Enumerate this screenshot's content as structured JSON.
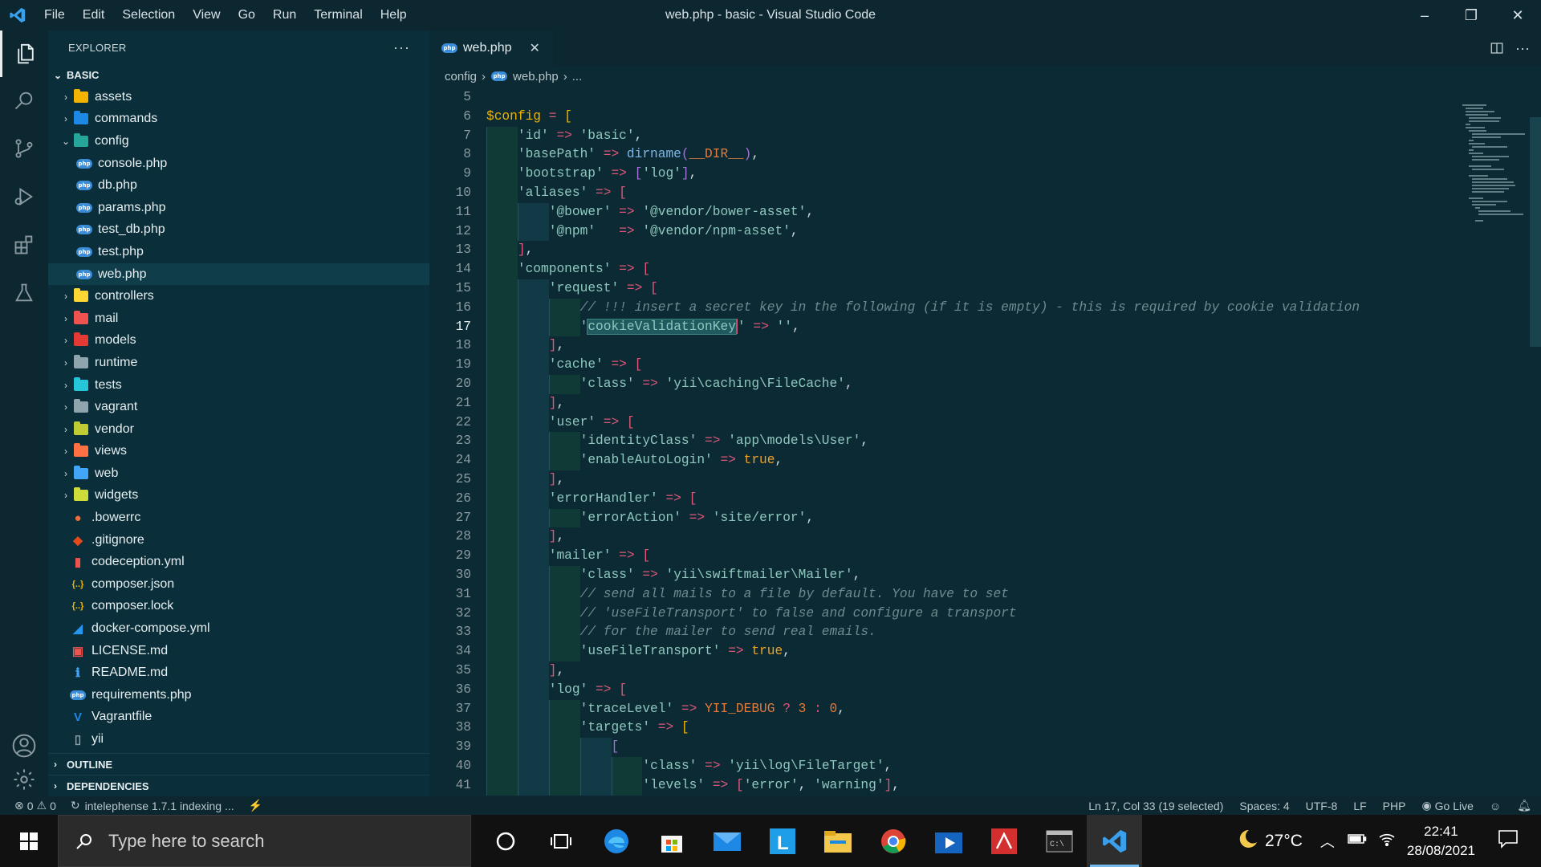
{
  "window": {
    "title": "web.php - basic - Visual Studio Code",
    "menu": [
      "File",
      "Edit",
      "Selection",
      "View",
      "Go",
      "Run",
      "Terminal",
      "Help"
    ],
    "controls": [
      "–",
      "❐",
      "✕"
    ]
  },
  "activity_bar": {
    "items": [
      "explorer-icon",
      "search-icon",
      "source-control-icon",
      "run-debug-icon",
      "extensions-icon",
      "testing-icon"
    ],
    "bottom": [
      "accounts-icon",
      "settings-gear-icon"
    ]
  },
  "sidebar": {
    "title": "EXPLORER",
    "more": "···",
    "root": "BASIC",
    "tree": [
      {
        "label": "assets",
        "type": "folder",
        "color": "#f2b400",
        "arrow": "›"
      },
      {
        "label": "commands",
        "type": "folder",
        "color": "#1e88e5",
        "arrow": "›"
      },
      {
        "label": "config",
        "type": "folder",
        "color": "#26a69a",
        "arrow": "⌄"
      },
      {
        "label": "console.php",
        "type": "php"
      },
      {
        "label": "db.php",
        "type": "php"
      },
      {
        "label": "params.php",
        "type": "php"
      },
      {
        "label": "test_db.php",
        "type": "php"
      },
      {
        "label": "test.php",
        "type": "php"
      },
      {
        "label": "web.php",
        "type": "php",
        "selected": true
      },
      {
        "label": "controllers",
        "type": "folder",
        "color": "#fdd835",
        "arrow": "›"
      },
      {
        "label": "mail",
        "type": "folder",
        "color": "#ef5350",
        "arrow": "›"
      },
      {
        "label": "models",
        "type": "folder",
        "color": "#e53935",
        "arrow": "›"
      },
      {
        "label": "runtime",
        "type": "folder",
        "color": "#90a4ae",
        "arrow": "›"
      },
      {
        "label": "tests",
        "type": "folder",
        "color": "#26c6da",
        "arrow": "›"
      },
      {
        "label": "vagrant",
        "type": "folder",
        "color": "#90a4ae",
        "arrow": "›"
      },
      {
        "label": "vendor",
        "type": "folder",
        "color": "#c0ca33",
        "arrow": "›"
      },
      {
        "label": "views",
        "type": "folder",
        "color": "#ff7043",
        "arrow": "›"
      },
      {
        "label": "web",
        "type": "folder",
        "color": "#42a5f5",
        "arrow": "›"
      },
      {
        "label": "widgets",
        "type": "folder",
        "color": "#cddc39",
        "arrow": "›"
      },
      {
        "label": ".bowerrc",
        "type": "file",
        "color": "#ef6c3b",
        "glyph": "●"
      },
      {
        "label": ".gitignore",
        "type": "file",
        "color": "#e64a19",
        "glyph": "◆"
      },
      {
        "label": "codeception.yml",
        "type": "file",
        "color": "#ef5350",
        "glyph": "▮"
      },
      {
        "label": "composer.json",
        "type": "file",
        "color": "#f2b400",
        "glyph": "{..}"
      },
      {
        "label": "composer.lock",
        "type": "file",
        "color": "#f2b400",
        "glyph": "{..}"
      },
      {
        "label": "docker-compose.yml",
        "type": "file",
        "color": "#2496ed",
        "glyph": "◢"
      },
      {
        "label": "LICENSE.md",
        "type": "file",
        "color": "#ef5350",
        "glyph": "▣"
      },
      {
        "label": "README.md",
        "type": "file",
        "color": "#42a5f5",
        "glyph": "ℹ"
      },
      {
        "label": "requirements.php",
        "type": "php"
      },
      {
        "label": "Vagrantfile",
        "type": "file",
        "color": "#1e88e5",
        "glyph": "V"
      },
      {
        "label": "yii",
        "type": "file",
        "color": "#90a4ae",
        "glyph": "▯"
      }
    ],
    "outline": "OUTLINE",
    "dependencies": "DEPENDENCIES"
  },
  "editor": {
    "tab": {
      "label": "web.php",
      "close": "✕"
    },
    "breadcrumb": {
      "folder": "config",
      "file": "web.php",
      "tail": "..."
    },
    "lines": [
      {
        "n": "5",
        "indent": 0,
        "tokens": []
      },
      {
        "n": "6",
        "indent": 0,
        "tokens": [
          [
            "var",
            "$config"
          ],
          [
            "op",
            " = "
          ],
          [
            "brk3",
            "["
          ]
        ]
      },
      {
        "n": "7",
        "indent": 1,
        "tokens": [
          [
            "str",
            "'id'"
          ],
          [
            "op",
            " => "
          ],
          [
            "str",
            "'basic'"
          ],
          [
            "txt",
            ","
          ]
        ]
      },
      {
        "n": "8",
        "indent": 1,
        "tokens": [
          [
            "str",
            "'basePath'"
          ],
          [
            "op",
            " => "
          ],
          [
            "fn",
            "dirname"
          ],
          [
            "brk2",
            "("
          ],
          [
            "const",
            "__DIR__"
          ],
          [
            "brk2",
            ")"
          ],
          [
            "txt",
            ","
          ]
        ]
      },
      {
        "n": "9",
        "indent": 1,
        "tokens": [
          [
            "str",
            "'bootstrap'"
          ],
          [
            "op",
            " => "
          ],
          [
            "brk2",
            "["
          ],
          [
            "str",
            "'log'"
          ],
          [
            "brk2",
            "]"
          ],
          [
            "txt",
            ","
          ]
        ]
      },
      {
        "n": "10",
        "indent": 1,
        "tokens": [
          [
            "str",
            "'aliases'"
          ],
          [
            "op",
            " => "
          ],
          [
            "brk",
            "["
          ]
        ]
      },
      {
        "n": "11",
        "indent": 2,
        "tokens": [
          [
            "str",
            "'@bower'"
          ],
          [
            "op",
            " => "
          ],
          [
            "str",
            "'@vendor/bower-asset'"
          ],
          [
            "txt",
            ","
          ]
        ]
      },
      {
        "n": "12",
        "indent": 2,
        "tokens": [
          [
            "str",
            "'@npm'"
          ],
          [
            "op",
            "   => "
          ],
          [
            "str",
            "'@vendor/npm-asset'"
          ],
          [
            "txt",
            ","
          ]
        ]
      },
      {
        "n": "13",
        "indent": 1,
        "tokens": [
          [
            "brk",
            "]"
          ],
          [
            "txt",
            ","
          ]
        ]
      },
      {
        "n": "14",
        "indent": 1,
        "tokens": [
          [
            "str",
            "'components'"
          ],
          [
            "op",
            " => "
          ],
          [
            "brk",
            "["
          ]
        ]
      },
      {
        "n": "15",
        "indent": 2,
        "tokens": [
          [
            "str",
            "'request'"
          ],
          [
            "op",
            " => "
          ],
          [
            "brk",
            "["
          ]
        ]
      },
      {
        "n": "16",
        "indent": 3,
        "tokens": [
          [
            "cmt",
            "// !!! insert a secret key in the following (if it is empty) - this is required by cookie validation"
          ]
        ]
      },
      {
        "n": "17",
        "indent": 3,
        "tokens": [
          [
            "str",
            "'"
          ],
          [
            "sel",
            "cookieValidationKey"
          ],
          [
            "cursor",
            ""
          ],
          [
            "str",
            "'"
          ],
          [
            "op",
            " => "
          ],
          [
            "str",
            "''"
          ],
          [
            "txt",
            ","
          ]
        ],
        "current": true
      },
      {
        "n": "18",
        "indent": 2,
        "tokens": [
          [
            "brk",
            "]"
          ],
          [
            "txt",
            ","
          ]
        ]
      },
      {
        "n": "19",
        "indent": 2,
        "tokens": [
          [
            "str",
            "'cache'"
          ],
          [
            "op",
            " => "
          ],
          [
            "brk",
            "["
          ]
        ]
      },
      {
        "n": "20",
        "indent": 3,
        "tokens": [
          [
            "str",
            "'class'"
          ],
          [
            "op",
            " => "
          ],
          [
            "str",
            "'yii\\caching\\FileCache'"
          ],
          [
            "txt",
            ","
          ]
        ]
      },
      {
        "n": "21",
        "indent": 2,
        "tokens": [
          [
            "brk",
            "]"
          ],
          [
            "txt",
            ","
          ]
        ]
      },
      {
        "n": "22",
        "indent": 2,
        "tokens": [
          [
            "str",
            "'user'"
          ],
          [
            "op",
            " => "
          ],
          [
            "brk",
            "["
          ]
        ]
      },
      {
        "n": "23",
        "indent": 3,
        "tokens": [
          [
            "str",
            "'identityClass'"
          ],
          [
            "op",
            " => "
          ],
          [
            "str",
            "'app\\models\\User'"
          ],
          [
            "txt",
            ","
          ]
        ]
      },
      {
        "n": "24",
        "indent": 3,
        "tokens": [
          [
            "str",
            "'enableAutoLogin'"
          ],
          [
            "op",
            " => "
          ],
          [
            "bool",
            "true"
          ],
          [
            "txt",
            ","
          ]
        ]
      },
      {
        "n": "25",
        "indent": 2,
        "tokens": [
          [
            "brk",
            "]"
          ],
          [
            "txt",
            ","
          ]
        ]
      },
      {
        "n": "26",
        "indent": 2,
        "tokens": [
          [
            "str",
            "'errorHandler'"
          ],
          [
            "op",
            " => "
          ],
          [
            "brk",
            "["
          ]
        ]
      },
      {
        "n": "27",
        "indent": 3,
        "tokens": [
          [
            "str",
            "'errorAction'"
          ],
          [
            "op",
            " => "
          ],
          [
            "str",
            "'site/error'"
          ],
          [
            "txt",
            ","
          ]
        ]
      },
      {
        "n": "28",
        "indent": 2,
        "tokens": [
          [
            "brk",
            "]"
          ],
          [
            "txt",
            ","
          ]
        ]
      },
      {
        "n": "29",
        "indent": 2,
        "tokens": [
          [
            "str",
            "'mailer'"
          ],
          [
            "op",
            " => "
          ],
          [
            "brk",
            "["
          ]
        ]
      },
      {
        "n": "30",
        "indent": 3,
        "tokens": [
          [
            "str",
            "'class'"
          ],
          [
            "op",
            " => "
          ],
          [
            "str",
            "'yii\\swiftmailer\\Mailer'"
          ],
          [
            "txt",
            ","
          ]
        ]
      },
      {
        "n": "31",
        "indent": 3,
        "tokens": [
          [
            "cmt",
            "// send all mails to a file by default. You have to set"
          ]
        ]
      },
      {
        "n": "32",
        "indent": 3,
        "tokens": [
          [
            "cmt",
            "// 'useFileTransport' to false and configure a transport"
          ]
        ]
      },
      {
        "n": "33",
        "indent": 3,
        "tokens": [
          [
            "cmt",
            "// for the mailer to send real emails."
          ]
        ]
      },
      {
        "n": "34",
        "indent": 3,
        "tokens": [
          [
            "str",
            "'useFileTransport'"
          ],
          [
            "op",
            " => "
          ],
          [
            "bool",
            "true"
          ],
          [
            "txt",
            ","
          ]
        ]
      },
      {
        "n": "35",
        "indent": 2,
        "tokens": [
          [
            "brk",
            "]"
          ],
          [
            "txt",
            ","
          ]
        ]
      },
      {
        "n": "36",
        "indent": 2,
        "tokens": [
          [
            "str",
            "'log'"
          ],
          [
            "op",
            " => "
          ],
          [
            "brk",
            "["
          ]
        ]
      },
      {
        "n": "37",
        "indent": 3,
        "tokens": [
          [
            "str",
            "'traceLevel'"
          ],
          [
            "op",
            " => "
          ],
          [
            "const",
            "YII_DEBUG"
          ],
          [
            "op",
            " ? "
          ],
          [
            "const",
            "3"
          ],
          [
            "op",
            " : "
          ],
          [
            "const",
            "0"
          ],
          [
            "txt",
            ","
          ]
        ]
      },
      {
        "n": "38",
        "indent": 3,
        "tokens": [
          [
            "str",
            "'targets'"
          ],
          [
            "op",
            " => "
          ],
          [
            "brk3",
            "["
          ]
        ]
      },
      {
        "n": "39",
        "indent": 4,
        "tokens": [
          [
            "brk2",
            "["
          ]
        ]
      },
      {
        "n": "40",
        "indent": 5,
        "tokens": [
          [
            "str",
            "'class'"
          ],
          [
            "op",
            " => "
          ],
          [
            "str",
            "'yii\\log\\FileTarget'"
          ],
          [
            "txt",
            ","
          ]
        ]
      },
      {
        "n": "41",
        "indent": 5,
        "tokens": [
          [
            "str",
            "'levels'"
          ],
          [
            "op",
            " => "
          ],
          [
            "brk",
            "["
          ],
          [
            "str",
            "'error'"
          ],
          [
            "txt",
            ", "
          ],
          [
            "str",
            "'warning'"
          ],
          [
            "brk",
            "]"
          ],
          [
            "txt",
            ","
          ]
        ]
      }
    ]
  },
  "statusbar": {
    "errors": "0",
    "warnings": "0",
    "indexing": "intelephense 1.7.1 indexing ...",
    "position": "Ln 17, Col 33 (19 selected)",
    "spaces": "Spaces: 4",
    "encoding": "UTF-8",
    "eol": "LF",
    "language": "PHP",
    "golive": "Go Live"
  },
  "taskbar": {
    "search_placeholder": "Type here to search",
    "apps": [
      "cortana-icon",
      "task-view-icon",
      "edge-icon",
      "store-icon",
      "mail-icon",
      "l-app-icon",
      "file-explorer-icon",
      "chrome-icon",
      "media-icon",
      "acrobat-icon",
      "terminal-icon",
      "vscode-icon"
    ],
    "temperature": "27°C",
    "time": "22:41",
    "date": "28/08/2021"
  }
}
